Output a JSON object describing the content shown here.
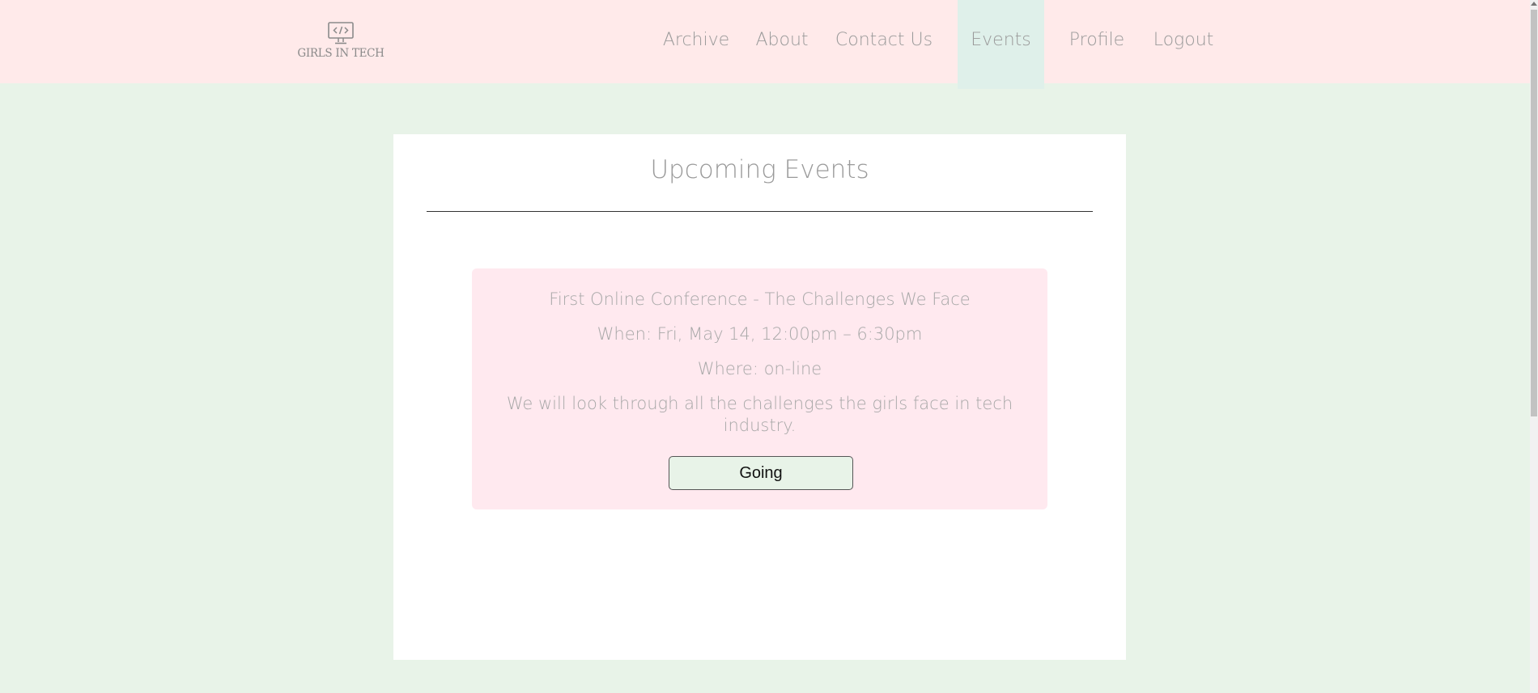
{
  "header": {
    "logo": {
      "icon": "monitor-code-icon",
      "glyph": "</>",
      "text": "GIRLS IN TECH"
    },
    "nav": [
      {
        "label": "Archive"
      },
      {
        "label": "About"
      },
      {
        "label": "Contact Us"
      },
      {
        "label": "Events",
        "active": true
      },
      {
        "label": "Profile"
      },
      {
        "label": "Logout"
      }
    ]
  },
  "main": {
    "title": "Upcoming Events",
    "events": [
      {
        "title": "First Online Conference - The Challenges We Face",
        "when": "When: Fri, May 14, 12:00pm – 6:30pm",
        "where": "Where: on-line",
        "description": "We will look through all the challenges the girls face in tech industry.",
        "button_label": "Going"
      }
    ]
  },
  "colors": {
    "page_background": "#e8f3e8",
    "header_background": "#ffeaea",
    "active_nav_background": "#dff0ea",
    "event_card_background": "#ffe9ef",
    "text_muted": "#9a9a9a"
  }
}
